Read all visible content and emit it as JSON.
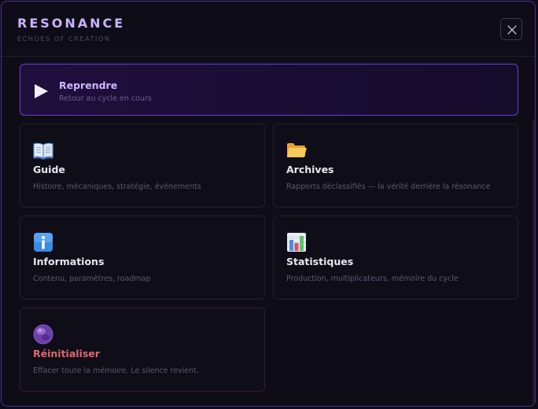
{
  "header": {
    "title": "RESONANCE",
    "subtitle": "ECHOES OF CREATION",
    "close_icon": "close-icon"
  },
  "resume": {
    "title": "Reprendre",
    "description": "Retour au cycle en cours",
    "icon": "play-icon"
  },
  "cards": [
    {
      "icon": "open-book-icon",
      "title": "Guide",
      "description": "Histoire, mécaniques, stratégie, événements"
    },
    {
      "icon": "folder-icon",
      "title": "Archives",
      "description": "Rapports déclassifiés — la vérité derrière la résonance"
    },
    {
      "icon": "info-icon",
      "title": "Informations",
      "description": "Contenu, paramètres, roadmap"
    },
    {
      "icon": "bar-chart-icon",
      "title": "Statistiques",
      "description": "Production, multiplicateurs, mémoire du cycle"
    },
    {
      "icon": "purple-orb-icon",
      "title": "Réinitialiser",
      "description": "Effacer toute la mémoire. Le silence revient."
    }
  ],
  "colors": {
    "accent": "#c9b3ff",
    "resume_border": "#6b3fd1",
    "danger": "#e0686e",
    "background": "#0e0d17"
  }
}
